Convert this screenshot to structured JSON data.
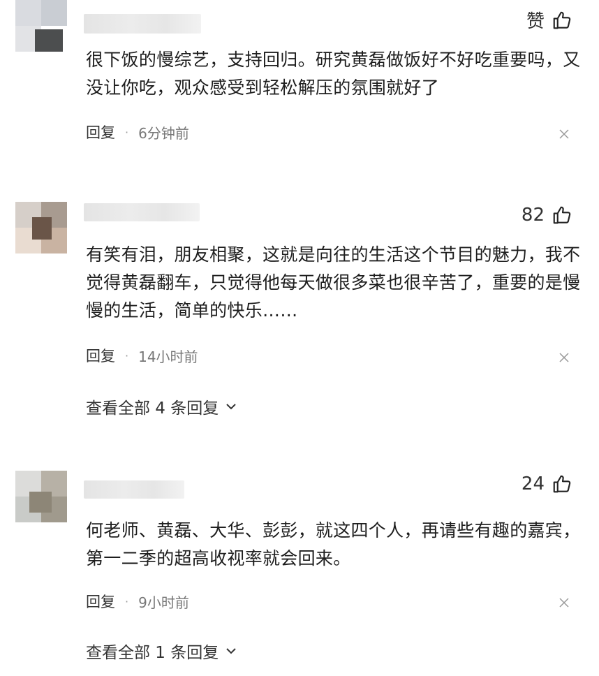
{
  "comments": [
    {
      "likes": "赞",
      "text": "很下饭的慢综艺，支持回归。研究黄磊做饭好不好吃重要吗，又没让你吃，观众感受到轻松解压的氛围就好了",
      "reply_label": "回复",
      "dot": "·",
      "time": "6分钟前"
    },
    {
      "likes": "82",
      "text": "有笑有泪，朋友相聚，这就是向往的生活这个节目的魅力，我不觉得黄磊翻车，只觉得他每天做很多菜也很辛苦了，重要的是慢慢的生活，简单的快乐……",
      "reply_label": "回复",
      "dot": "·",
      "time": "14小时前",
      "view_all": "查看全部 4 条回复"
    },
    {
      "likes": "24",
      "text": "何老师、黄磊、大华、彭彭，就这四个人，再请些有趣的嘉宾，第一二季的超高收视率就会回来。",
      "reply_label": "回复",
      "dot": "·",
      "time": "9小时前",
      "view_all": "查看全部 1 条回复"
    }
  ],
  "icons": {
    "like": "thumbs-up-icon",
    "close": "close-icon",
    "chevron": "chevron-down-icon"
  }
}
